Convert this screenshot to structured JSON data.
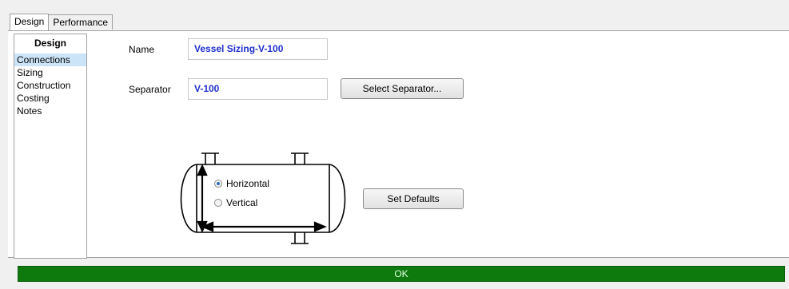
{
  "tabs": [
    {
      "label": "Design"
    },
    {
      "label": "Performance"
    }
  ],
  "sidebar": {
    "heading": "Design",
    "items": [
      {
        "label": "Connections",
        "selected": true
      },
      {
        "label": "Sizing"
      },
      {
        "label": "Construction"
      },
      {
        "label": "Costing"
      },
      {
        "label": "Notes"
      }
    ]
  },
  "form": {
    "name_label": "Name",
    "name_value": "Vessel Sizing-V-100",
    "separator_label": "Separator",
    "separator_value": "V-100",
    "select_separator_button": "Select Separator...",
    "orientation": {
      "options": [
        "Horizontal",
        "Vertical"
      ],
      "selected": "Horizontal"
    },
    "set_defaults_button": "Set Defaults"
  },
  "ok_button": "OK",
  "colors": {
    "field_text": "#1f2fcf",
    "ok_bar": "#0e7a0e",
    "selection": "#cce4f7"
  }
}
